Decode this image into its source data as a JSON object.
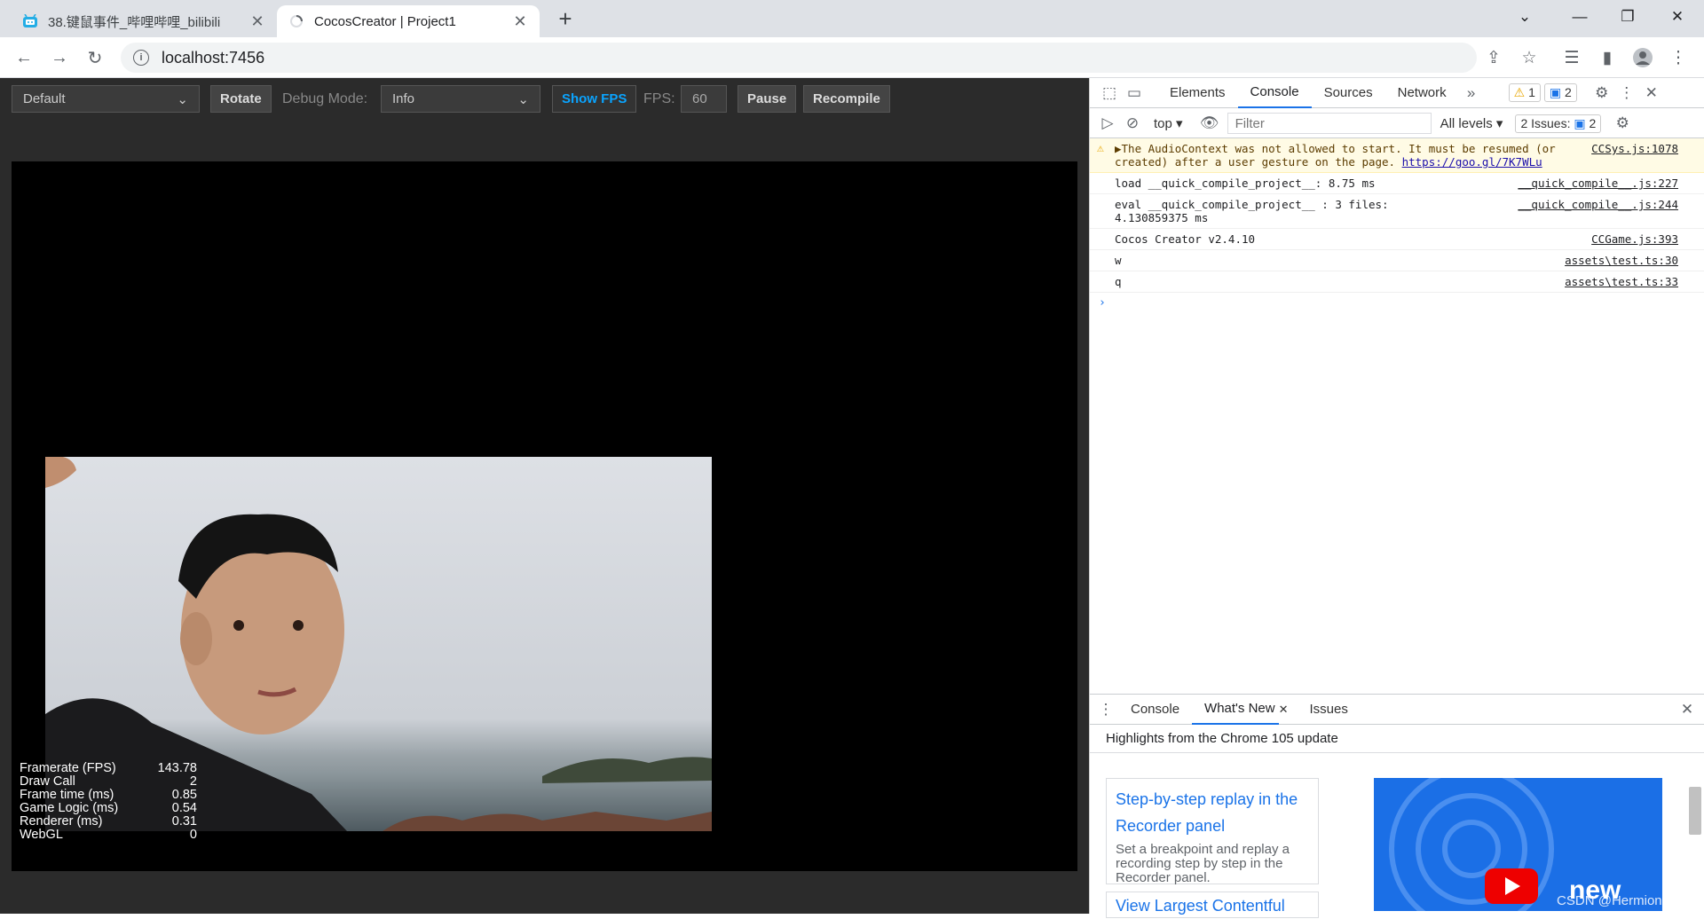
{
  "browser": {
    "tabs": [
      {
        "title": "38.键鼠事件_哔哩哔哩_bilibili",
        "icon": "bilibili-icon"
      },
      {
        "title": "CocosCreator | Project1",
        "icon": "loading-icon"
      }
    ],
    "url": "localhost:7456"
  },
  "toolbar": {
    "device_select": "Default",
    "rotate_label": "Rotate",
    "debug_mode_label": "Debug Mode:",
    "debug_mode_value": "Info",
    "show_fps_label": "Show FPS",
    "fps_label": "FPS:",
    "fps_value": "60",
    "pause_label": "Pause",
    "recompile_label": "Recompile"
  },
  "stats": [
    {
      "label": "Framerate (FPS)",
      "value": "143.78"
    },
    {
      "label": "Draw Call",
      "value": "2"
    },
    {
      "label": "Frame time (ms)",
      "value": "0.85"
    },
    {
      "label": "Game Logic (ms)",
      "value": "0.54"
    },
    {
      "label": "Renderer (ms)",
      "value": "0.31"
    },
    {
      "label": "WebGL",
      "value": "0"
    }
  ],
  "devtools": {
    "tabs": [
      "Elements",
      "Console",
      "Sources",
      "Network"
    ],
    "active_tab": "Console",
    "warnings_count": "1",
    "messages_count": "2",
    "context": "top",
    "filter_placeholder": "Filter",
    "levels": "All levels",
    "issues_label": "2 Issues:",
    "issues_count": "2",
    "console": [
      {
        "text": "▶The AudioContext was not allowed to start. It must be resumed (or created) after a user gesture on the page.",
        "link": "https://goo.gl/7K7WLu",
        "source": "CCSys.js:1078",
        "level": "warning"
      },
      {
        "text": "load __quick_compile_project__: 8.75 ms",
        "source": "__quick_compile__.js:227",
        "level": "info"
      },
      {
        "text": "eval __quick_compile_project__ : 3 files: 4.130859375 ms",
        "source": "__quick_compile__.js:244",
        "level": "info"
      },
      {
        "text": "Cocos Creator v2.4.10",
        "source": "CCGame.js:393",
        "level": "info"
      },
      {
        "text": "w",
        "source": "assets\\test.ts:30",
        "level": "info"
      },
      {
        "text": "q",
        "source": "assets\\test.ts:33",
        "level": "info"
      }
    ],
    "drawer": {
      "tabs": [
        "Console",
        "What's New",
        "Issues"
      ],
      "active": "What's New",
      "heading": "Highlights from the Chrome 105 update",
      "cards": [
        {
          "title": "Step-by-step replay in the Recorder panel",
          "desc": "Set a breakpoint and replay a recording step by step in the Recorder panel."
        },
        {
          "title": "View Largest Contentful",
          "desc": ""
        }
      ],
      "promo_text": "new"
    }
  },
  "watermark": "CSDN @Hermioneee_"
}
